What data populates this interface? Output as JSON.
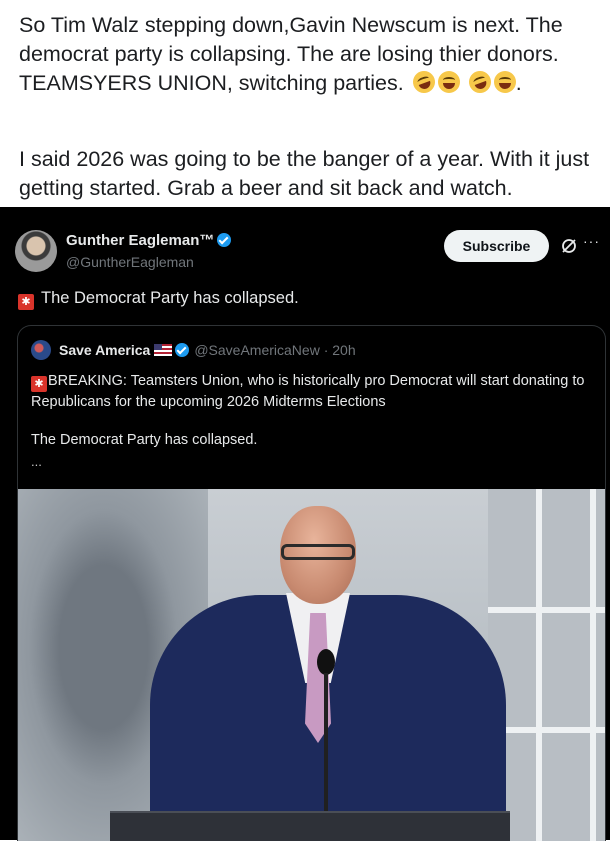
{
  "post": {
    "paragraph1": "So Tim Walz  stepping down,Gavin Newscum is next. The democrat party is collapsing. The are losing thier donors.  TEAMSYERS UNION, switching parties.",
    "paragraph1_tail": ".",
    "paragraph2": "I said 2026 was going to be the banger of  a year. With it just getting started. Grab a beer and sit back and watch.",
    "emojis": [
      "rolling-on-floor-laughing",
      "tears-of-joy",
      "rolling-on-floor-laughing",
      "tears-of-joy"
    ]
  },
  "tweet": {
    "author_name": "Gunther Eagleman™",
    "author_handle": "@GuntherEagleman",
    "subscribe_label": "Subscribe",
    "more_label": "···",
    "text": "The Democrat Party has collapsed.",
    "alarm_glyph": "✱",
    "quote": {
      "author_name": "Save America",
      "author_handle": "@SaveAmericaNew · 20h",
      "text": "BREAKING: Teamsters Union, who is historically pro Democrat will start donating to Republicans for the upcoming 2026 Midterms Elections",
      "text2": "The Democrat Party has collapsed.",
      "ellipsis": "..."
    }
  },
  "colors": {
    "tweet_background": "#000000",
    "verified_blue": "#1d9bf0",
    "muted_text": "#71767b",
    "alarm_red": "#d9342b"
  }
}
